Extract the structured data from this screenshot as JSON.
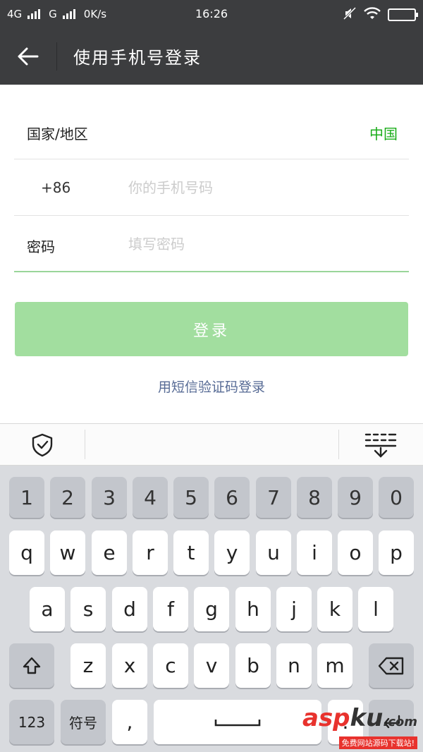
{
  "status_bar": {
    "network_1": "4G",
    "network_2": "G",
    "speed": "0K/s",
    "time": "16:26"
  },
  "app_bar": {
    "title": "使用手机号登录"
  },
  "form": {
    "region_label": "国家/地区",
    "region_value": "中国",
    "country_code": "+86",
    "phone_placeholder": "你的手机号码",
    "password_label": "密码",
    "password_placeholder": "填写密码"
  },
  "login_button": "登录",
  "sms_login_link": "用短信验证码登录",
  "keyboard": {
    "numbers": [
      "1",
      "2",
      "3",
      "4",
      "5",
      "6",
      "7",
      "8",
      "9",
      "0"
    ],
    "row1": [
      "q",
      "w",
      "e",
      "r",
      "t",
      "y",
      "u",
      "i",
      "o",
      "p"
    ],
    "row2": [
      "a",
      "s",
      "d",
      "f",
      "g",
      "h",
      "j",
      "k",
      "l"
    ],
    "row3": [
      "z",
      "x",
      "c",
      "v",
      "b",
      "n",
      "m"
    ],
    "num_mode_label": "123",
    "symbol_label": "符号",
    "comma": ",",
    "period": "."
  },
  "watermark": {
    "brand_prefix": "asp",
    "brand_suffix": "ku",
    "domain": ".com",
    "tagline": "免费网站源码下载站!"
  },
  "colors": {
    "bar_bg": "#3c3d3f",
    "accent_green": "#1aad19",
    "button_disabled": "#a2de9f",
    "link_blue": "#576b95"
  }
}
